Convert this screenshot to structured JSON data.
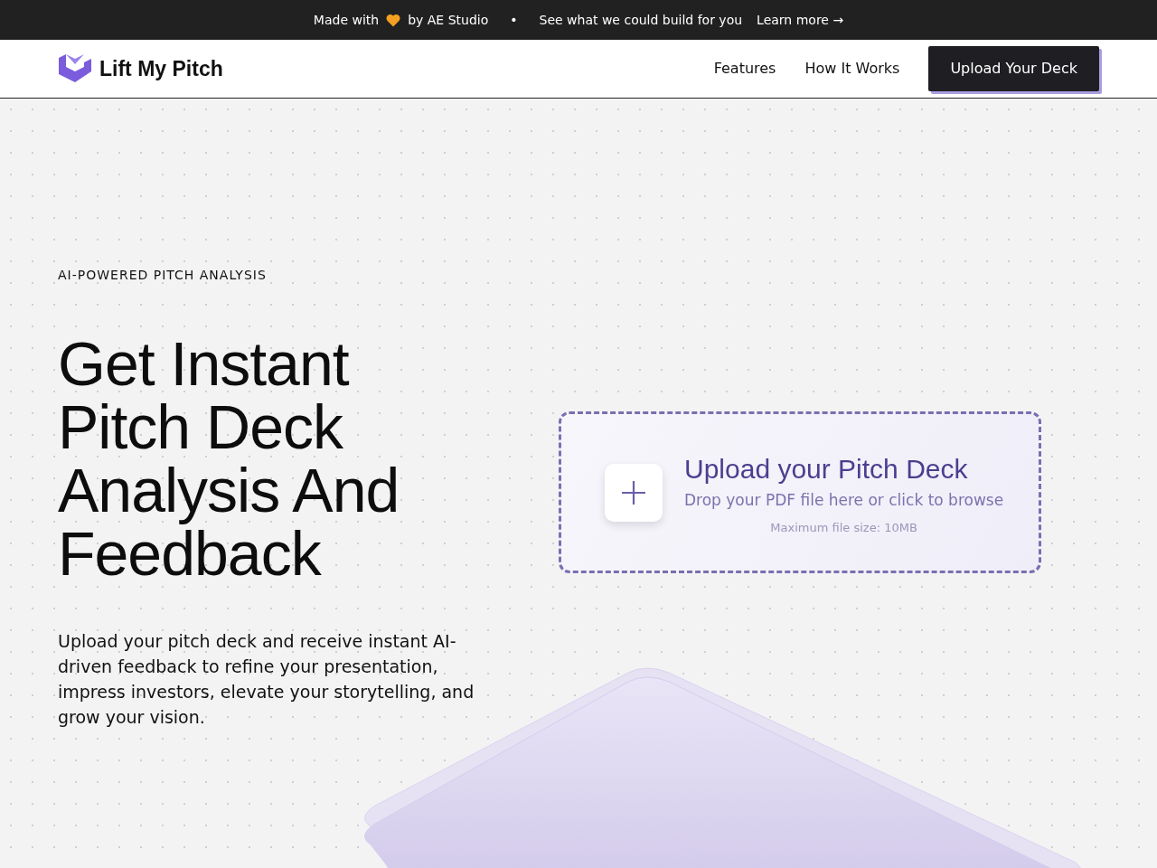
{
  "announcement": {
    "before": "Made with",
    "after": "by AE Studio",
    "separator": "•",
    "message": "See what we could build for you",
    "link": "Learn more →"
  },
  "navbar": {
    "brand": "Lift My Pitch",
    "links": [
      "Features",
      "How It Works"
    ],
    "cta": "Upload Your Deck"
  },
  "hero": {
    "eyebrow": "AI-POWERED PITCH ANALYSIS",
    "title": "Get Instant Pitch Deck Analysis And Feedback",
    "description": "Upload your pitch deck and receive instant AI-driven feedback to refine your presentation, impress investors, elevate your storytelling, and grow your vision."
  },
  "upload": {
    "title": "Upload your Pitch Deck",
    "subtitle": "Drop your PDF file here or click to browse",
    "limit": "Maximum file size: 10MB"
  }
}
